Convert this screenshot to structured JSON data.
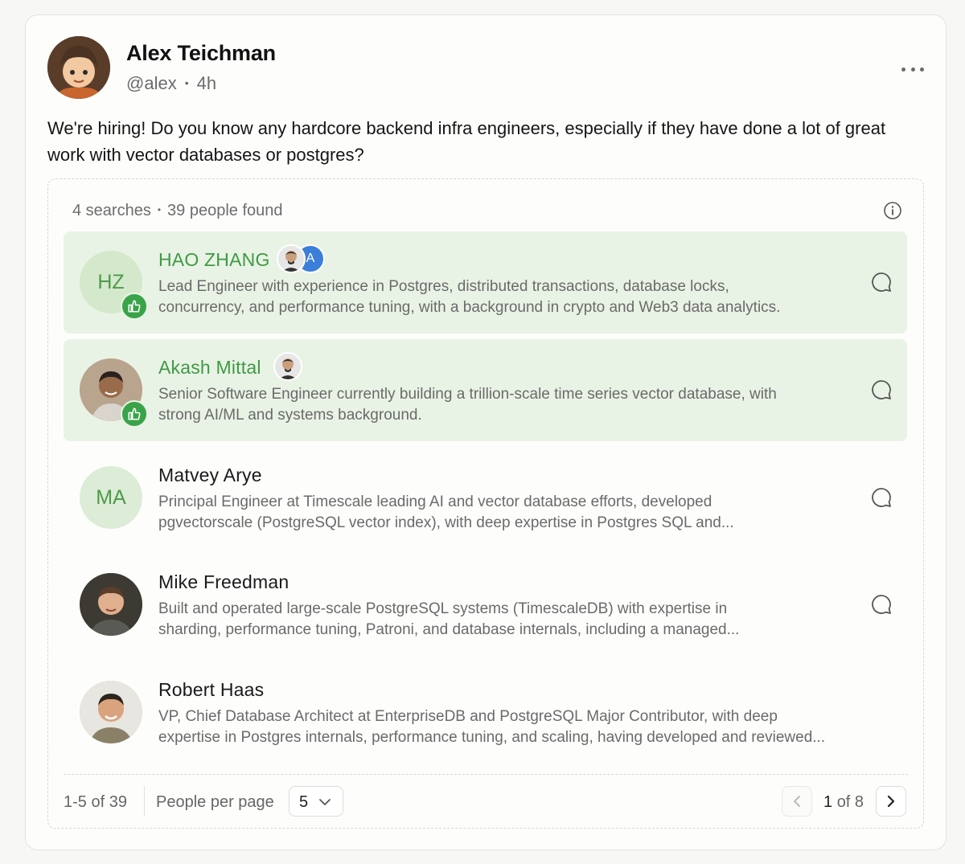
{
  "post": {
    "author_name": "Alex Teichman",
    "handle": "@alex",
    "separator": "•",
    "time": "4h",
    "body": "We're hiring! Do you know any hardcore backend infra engineers, especially if they have done a lot of great work with vector databases or postgres?"
  },
  "results": {
    "searches": "4 searches",
    "separator": "•",
    "found": "39 people found",
    "people": [
      {
        "initials": "HZ",
        "name": "HAO ZHANG",
        "liked": true,
        "mini_avatar_letter": "A",
        "description": "Lead Engineer with experience in Postgres, distributed transactions, database locks,\nconcurrency, and performance tuning, with a background in crypto and Web3 data analytics."
      },
      {
        "initials": "",
        "name": "Akash Mittal",
        "liked": true,
        "description": "Senior Software Engineer currently building a trillion-scale time series vector database, with\nstrong AI/ML and systems background."
      },
      {
        "initials": "MA",
        "name": "Matvey Arye",
        "liked": false,
        "description": "Principal Engineer at Timescale leading AI and vector database efforts, developed\npgvectorscale (PostgreSQL vector index), with deep expertise in Postgres SQL and..."
      },
      {
        "initials": "",
        "name": "Mike Freedman",
        "liked": false,
        "description": "Built and operated large-scale PostgreSQL systems (TimescaleDB) with expertise in\nsharding, performance tuning, Patroni, and database internals, including a managed..."
      },
      {
        "initials": "",
        "name": "Robert Haas",
        "liked": false,
        "description": "VP, Chief Database Architect at EnterpriseDB and PostgreSQL Major Contributor, with deep\nexpertise in Postgres internals, performance tuning, and scaling, having developed and reviewed..."
      }
    ]
  },
  "pagination": {
    "range": "1-5 of 39",
    "per_page_label": "People per page",
    "per_page_value": "5",
    "current_page": "1",
    "of_label": "of 8"
  },
  "colors": {
    "accent_green": "#3e9a45",
    "liked_bg": "#e9f3e5",
    "like_badge": "#3aa34a"
  },
  "icons": {
    "more": "more-horizontal-icon",
    "info": "info-icon",
    "like": "thumbs-up-icon",
    "message": "message-circle-icon",
    "chevron_down": "chevron-down-icon",
    "chevron_left": "chevron-left-icon",
    "chevron_right": "chevron-right-icon"
  }
}
